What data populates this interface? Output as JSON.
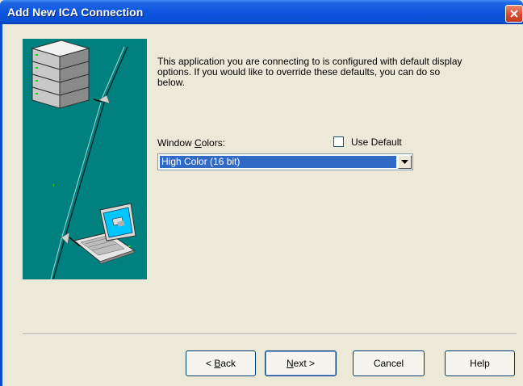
{
  "window": {
    "title": "Add New ICA Connection"
  },
  "content": {
    "intro_text": "This application you are connecting to is configured with default display options.  If you would like to override these defaults, you can do so below.",
    "window_colors": {
      "label_prefix": "Window ",
      "label_accel": "C",
      "label_suffix": "olors:",
      "use_default_label": "Use Default",
      "use_default_checked": false,
      "selected_value": "High Color (16 bit)"
    }
  },
  "buttons": {
    "back_prefix": "< ",
    "back_accel": "B",
    "back_suffix": "ack",
    "next_accel": "N",
    "next_suffix": "ext >",
    "cancel": "Cancel",
    "help": "Help"
  },
  "colors": {
    "titlebar": "#0a4fd3",
    "illustration_bg": "#00807e",
    "selection": "#316ac5",
    "dialog_bg": "#ece9d8"
  },
  "icons": [
    "close-icon",
    "server-stack-icon",
    "laptop-icon",
    "network-cable-icon",
    "dropdown-arrow-icon"
  ]
}
